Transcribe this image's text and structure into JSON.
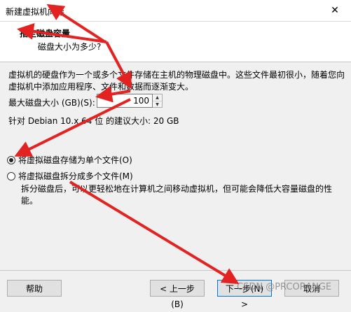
{
  "window": {
    "title": "新建虚拟机向导",
    "close_glyph": "✕"
  },
  "header": {
    "title": "指定磁盘容量",
    "subtitle": "磁盘大小为多少?"
  },
  "description": "虚拟机的硬盘作为一个或多个文件存储在主机的物理磁盘中。这些文件最初很小，随着您向虚拟机中添加应用程序、文件和数据而逐渐变大。",
  "disk_size": {
    "label": "最大磁盘大小 (GB)(S):",
    "value": "100"
  },
  "recommend": "针对 Debian 10.x 64 位 的建议大小: 20 GB",
  "options": {
    "single": {
      "label": "将虚拟磁盘存储为单个文件(O)",
      "checked": true
    },
    "split": {
      "label": "将虚拟磁盘拆分成多个文件(M)",
      "checked": false
    },
    "split_note": "拆分磁盘后，可以更轻松地在计算机之间移动虚拟机，但可能会降低大容量磁盘的性能。"
  },
  "footer": {
    "help": "帮助",
    "back": "< 上一步(B)",
    "next": "下一步(N) >",
    "cancel": "取消"
  },
  "watermark": "CSDN @PRCORANGE",
  "colors": {
    "annotation_arrow": "#e32222",
    "focus_border": "#0078d7"
  }
}
